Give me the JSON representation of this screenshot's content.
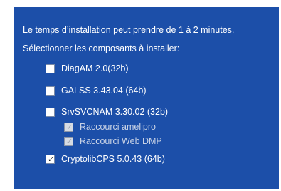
{
  "intro": {
    "duration_text": "Le temps d’installation peut prendre de 1 à 2 minutes.",
    "select_text": "Sélectionner les composants à installer:"
  },
  "components": [
    {
      "label": "DiagAM 2.0(32b)",
      "checked": false,
      "enabled": true
    },
    {
      "label": "GALSS 3.43.04 (64b)",
      "checked": false,
      "enabled": true
    },
    {
      "label": "SrvSVCNAM 3.30.02 (32b)",
      "checked": false,
      "enabled": true
    },
    {
      "label": "Raccourci amelipro",
      "checked": true,
      "enabled": false
    },
    {
      "label": "Raccourci Web DMP",
      "checked": true,
      "enabled": false
    },
    {
      "label": "CryptolibCPS 5.0.43 (64b)",
      "checked": true,
      "enabled": true
    }
  ],
  "colors": {
    "panel_bg": "#1c4fa9",
    "text": "#ffffff"
  }
}
